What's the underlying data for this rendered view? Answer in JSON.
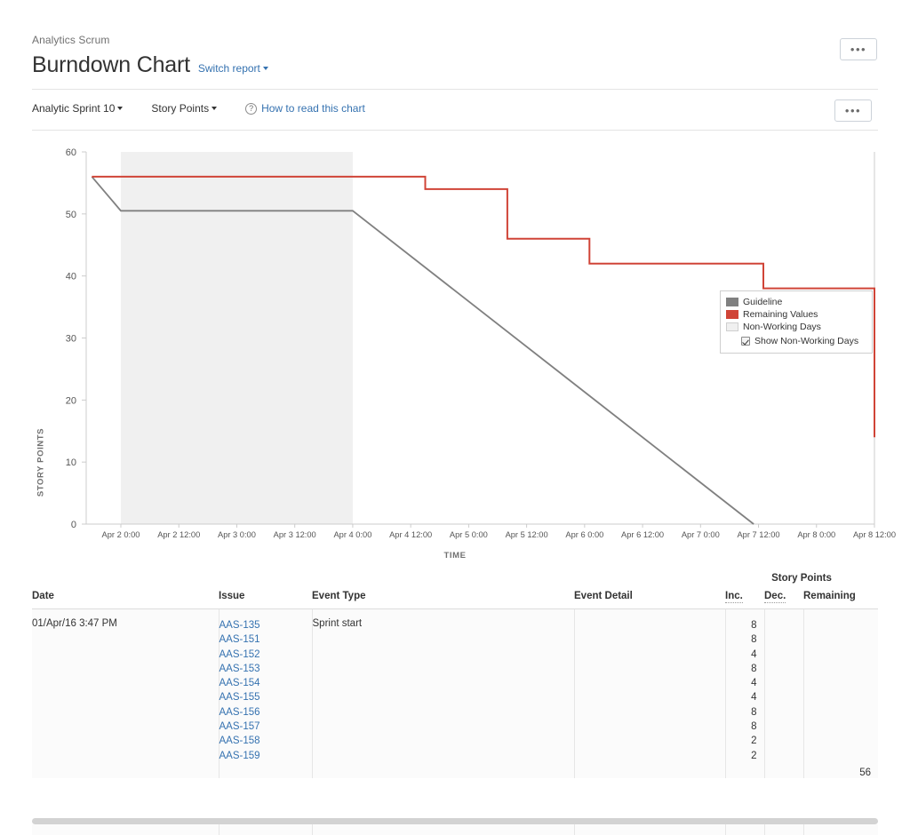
{
  "header": {
    "breadcrumb": "Analytics Scrum",
    "title": "Burndown Chart",
    "switch_report": "Switch report",
    "more_button": "•••"
  },
  "toolbar": {
    "sprint_select": "Analytic Sprint 10",
    "unit_select": "Story Points",
    "help_link": "How to read this chart",
    "help_icon": "question-circle-icon",
    "more_button": "•••"
  },
  "legend": {
    "items": [
      {
        "label": "Guideline",
        "color": "#808080"
      },
      {
        "label": "Remaining Values",
        "color": "#d04437"
      },
      {
        "label": "Non-Working Days",
        "color": "#f0f0f0"
      }
    ],
    "checkbox_label": "Show Non-Working Days",
    "checkbox_checked": true
  },
  "chart_data": {
    "type": "line",
    "title": "Burndown Chart",
    "xlabel": "TIME",
    "ylabel": "STORY POINTS",
    "ylim": [
      0,
      60
    ],
    "yticks": [
      0,
      10,
      20,
      30,
      40,
      50,
      60
    ],
    "xticks": [
      "Apr 2 0:00",
      "Apr 2 12:00",
      "Apr 3 0:00",
      "Apr 3 12:00",
      "Apr 4 0:00",
      "Apr 4 12:00",
      "Apr 5 0:00",
      "Apr 5 12:00",
      "Apr 6 0:00",
      "Apr 6 12:00",
      "Apr 7 0:00",
      "Apr 7 12:00",
      "Apr 8 0:00",
      "Apr 8 12:00"
    ],
    "grid": false,
    "legend_position": "top-right",
    "series": [
      {
        "name": "Guideline",
        "color": "#808080",
        "type": "line",
        "points": [
          {
            "x": "Apr 1 18:00",
            "y": 56
          },
          {
            "x": "Apr 2 0:00",
            "y": 50.5
          },
          {
            "x": "Apr 4 0:00",
            "y": 50.5
          },
          {
            "x": "Apr 7 11:00",
            "y": 0
          }
        ]
      },
      {
        "name": "Remaining Values",
        "color": "#d04437",
        "type": "step",
        "points": [
          {
            "x": "Apr 1 18:00",
            "y": 56
          },
          {
            "x": "Apr 4 15:00",
            "y": 56
          },
          {
            "x": "Apr 4 15:00",
            "y": 54
          },
          {
            "x": "Apr 5 8:00",
            "y": 54
          },
          {
            "x": "Apr 5 8:00",
            "y": 46
          },
          {
            "x": "Apr 6 1:00",
            "y": 46
          },
          {
            "x": "Apr 6 1:00",
            "y": 42
          },
          {
            "x": "Apr 7 13:00",
            "y": 42
          },
          {
            "x": "Apr 7 13:00",
            "y": 38
          },
          {
            "x": "Apr 8 12:00",
            "y": 38
          },
          {
            "x": "Apr 8 12:00",
            "y": 14
          }
        ]
      }
    ],
    "shaded_regions": [
      {
        "name": "Non-Working Days",
        "from": "Apr 2 0:00",
        "to": "Apr 4 0:00",
        "color": "#f0f0f0"
      }
    ]
  },
  "table": {
    "group_header": "Story Points",
    "columns": [
      "Date",
      "Issue",
      "Event Type",
      "Event Detail",
      "Inc.",
      "Dec.",
      "Remaining"
    ],
    "rows": [
      {
        "date": "01/Apr/16 3:47 PM",
        "event_type": "Sprint start",
        "event_detail": "",
        "issues": [
          {
            "key": "AAS-135",
            "inc": "8",
            "dec": ""
          },
          {
            "key": "AAS-151",
            "inc": "8",
            "dec": ""
          },
          {
            "key": "AAS-152",
            "inc": "4",
            "dec": ""
          },
          {
            "key": "AAS-153",
            "inc": "8",
            "dec": ""
          },
          {
            "key": "AAS-154",
            "inc": "4",
            "dec": ""
          },
          {
            "key": "AAS-155",
            "inc": "4",
            "dec": ""
          },
          {
            "key": "AAS-156",
            "inc": "8",
            "dec": ""
          },
          {
            "key": "AAS-157",
            "inc": "8",
            "dec": ""
          },
          {
            "key": "AAS-158",
            "inc": "2",
            "dec": ""
          },
          {
            "key": "AAS-159",
            "inc": "2",
            "dec": ""
          }
        ],
        "remaining": "56"
      }
    ]
  }
}
